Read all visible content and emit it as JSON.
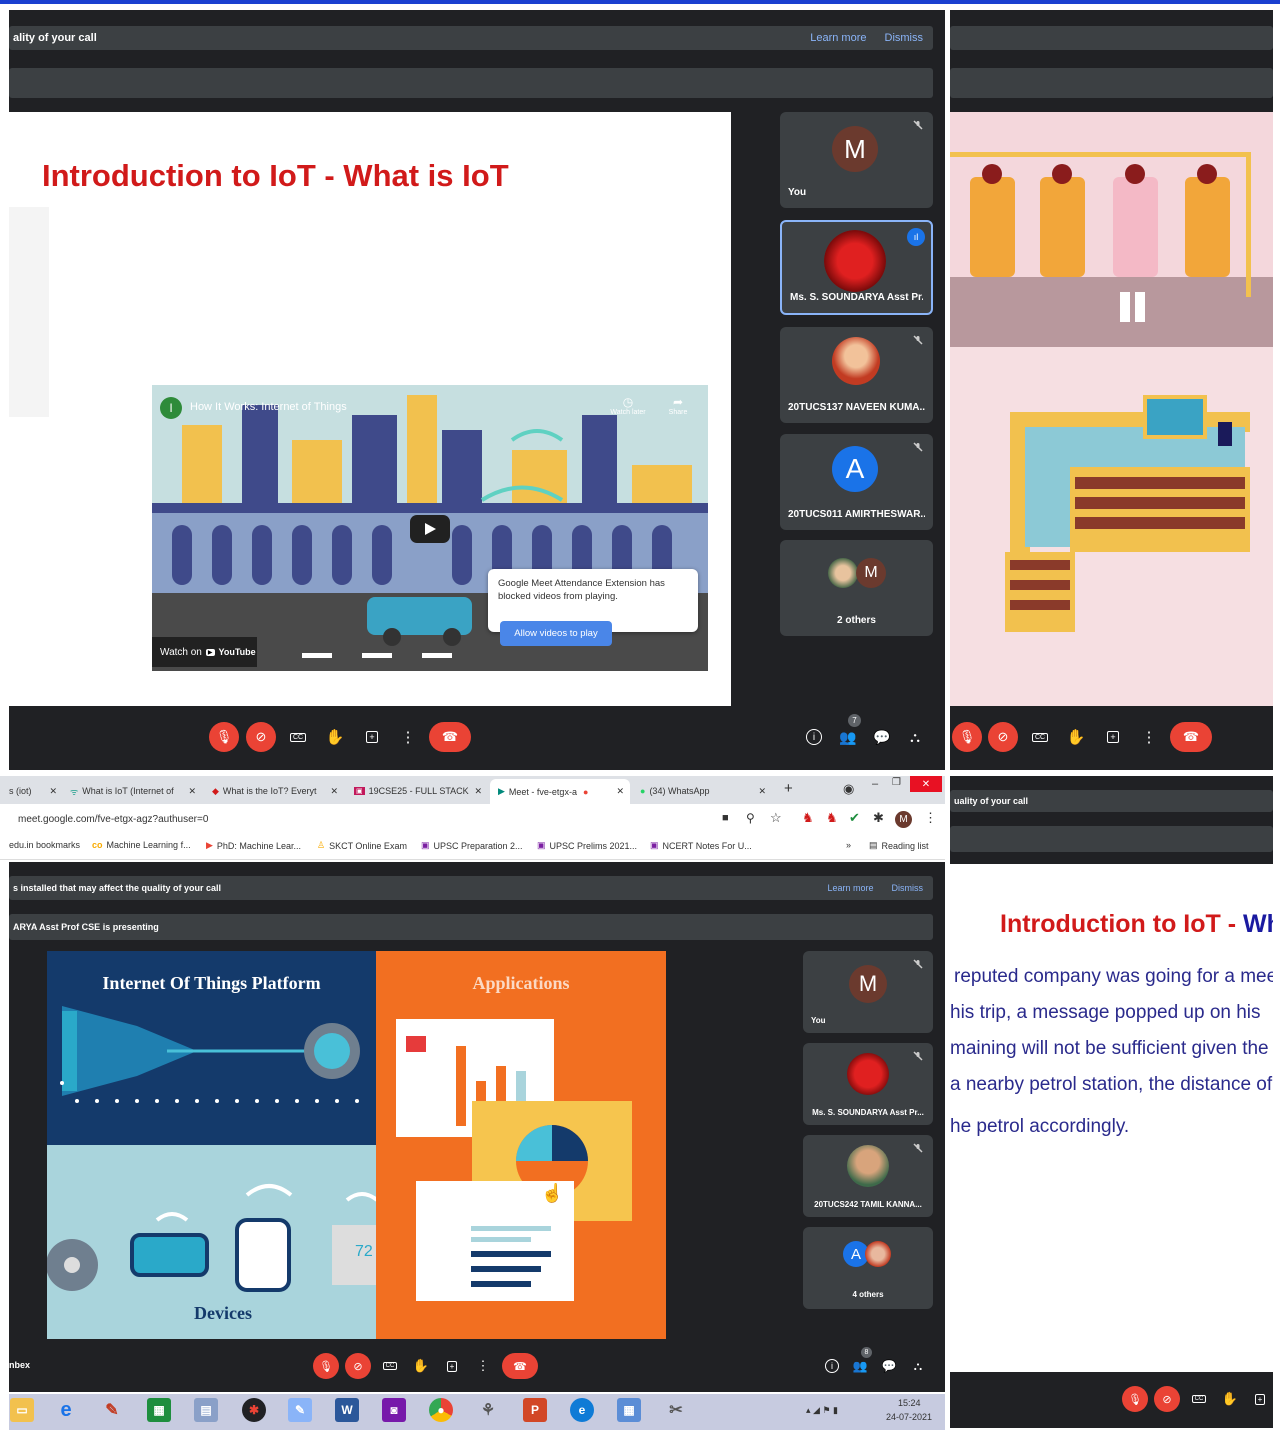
{
  "q1": {
    "notice": "ality of your call",
    "learn_more": "Learn more",
    "dismiss": "Dismiss",
    "slide_title": "Introduction to IoT - What is IoT",
    "video": {
      "title": "How It Works: Internet of Things",
      "watch_later": "Watch later",
      "share": "Share",
      "watch_on": "Watch on",
      "youtube": "YouTube",
      "channel_initial": "I"
    },
    "popup": {
      "text": "Google Meet Attendance Extension has blocked videos from playing.",
      "button": "Allow videos to play"
    },
    "participants": [
      {
        "initial": "M",
        "name": "You"
      },
      {
        "initial": "",
        "name": "Ms. S. SOUNDARYA Asst Pr..."
      },
      {
        "initial": "",
        "name": "20TUCS137 NAVEEN KUMA..."
      },
      {
        "initial": "A",
        "name": "20TUCS011 AMIRTHESWAR..."
      },
      {
        "initial": "M",
        "name": "2 others"
      }
    ],
    "people_count": "7"
  },
  "q3": {
    "tabs": [
      "s (iot)",
      "What is IoT (Internet of",
      "What is the IoT? Everyt",
      "19CSE25 - FULL STACK",
      "Meet - fve-etgx-a",
      "(34) WhatsApp"
    ],
    "url": "meet.google.com/fve-etgx-agz?authuser=0",
    "profile_initial": "M",
    "bookmarks": [
      "edu.in bookmarks",
      "Machine Learning f...",
      "PhD: Machine Lear...",
      "SKCT Online Exam",
      "UPSC Preparation 2...",
      "UPSC Prelims 2021...",
      "NCERT Notes For U..."
    ],
    "bookmarks_more": "»",
    "reading_list": "Reading list",
    "notice": "s installed that may affect the quality of your call",
    "learn_more": "Learn more",
    "dismiss": "Dismiss",
    "presenting": "ARYA Asst Prof CSE is presenting",
    "slide": {
      "left_title": "Internet Of Things Platform",
      "right_title": "Applications",
      "devices": "Devices",
      "temp": "72"
    },
    "participants": [
      {
        "initial": "M",
        "name": "You"
      },
      {
        "initial": "",
        "name": "Ms. S. SOUNDARYA Asst Pr..."
      },
      {
        "initial": "",
        "name": "20TUCS242 TAMIL KANNA..."
      },
      {
        "initial": "A",
        "name": "4 others"
      }
    ],
    "people_count": "8",
    "left_cut": "nbex",
    "time": "15:24",
    "date": "24-07-2021"
  },
  "q4": {
    "notice": "uality of your call",
    "slide_title_a": "Introduction to IoT - ",
    "slide_title_b": "Wh",
    "lines": [
      "reputed company was going for a mee",
      "his trip, a message popped up on his",
      "maining will not be sufficient given the",
      "a nearby petrol station, the distance of th",
      "he petrol accordingly."
    ]
  }
}
